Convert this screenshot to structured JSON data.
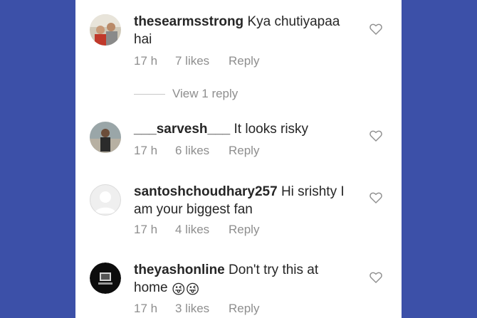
{
  "comments": [
    {
      "username": "thesearmsstrong",
      "text": "Kya chutiyapaa hai",
      "time": "17 h",
      "likes": "7 likes",
      "reply": "Reply",
      "avatar": "group-photo-avatar"
    },
    {
      "username": "___sarvesh___",
      "text": "It looks risky",
      "time": "17 h",
      "likes": "6 likes",
      "reply": "Reply",
      "avatar": "person-photo-avatar"
    },
    {
      "username": "santoshchoudhary257",
      "text": "Hi srishty I am your biggest fan",
      "time": "17 h",
      "likes": "4 likes",
      "reply": "Reply",
      "avatar": "default-user-avatar"
    },
    {
      "username": "theyashonline",
      "text": "Don't try this at home",
      "emoji": "😜😜",
      "time": "17 h",
      "likes": "3 likes",
      "reply": "Reply",
      "avatar": "dark-logo-avatar"
    }
  ],
  "view_replies": "View 1 reply",
  "icons": {
    "like": "heart-outline-icon"
  },
  "colors": {
    "background": "#3c50a8",
    "panel": "#ffffff",
    "text": "#262626",
    "muted": "#8e8e8e"
  }
}
